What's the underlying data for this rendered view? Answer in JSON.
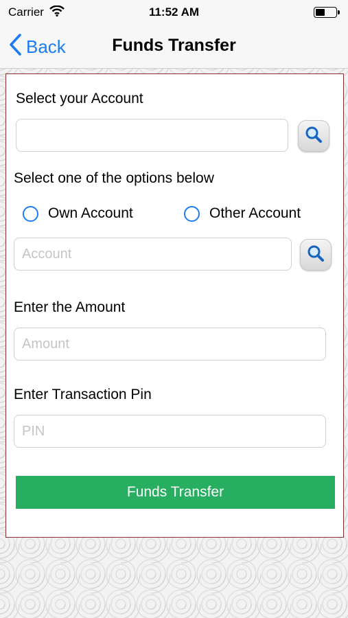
{
  "status_bar": {
    "carrier": "Carrier",
    "time": "11:52 AM",
    "battery_level": 0.45,
    "wifi_icon": "wifi-icon",
    "battery_icon": "battery-icon"
  },
  "nav": {
    "back_label": "Back",
    "back_icon": "chevron-left-icon",
    "title": "Funds Transfer"
  },
  "form": {
    "account_label": "Select your Account",
    "account_value": "",
    "account_placeholder": "",
    "options_label": "Select one of the options below",
    "options": [
      {
        "label": "Own Account",
        "selected": false
      },
      {
        "label": "Other Account",
        "selected": false
      }
    ],
    "target_account_placeholder": "Account",
    "amount_label": "Enter the Amount",
    "amount_placeholder": "Amount",
    "pin_label": "Enter Transaction Pin",
    "pin_placeholder": "PIN",
    "submit_label": "Funds Transfer",
    "search_icon": "search-icon"
  },
  "colors": {
    "accent": "#1a7cf0",
    "submit": "#27ae60",
    "panel_border": "#8b2e2e"
  }
}
